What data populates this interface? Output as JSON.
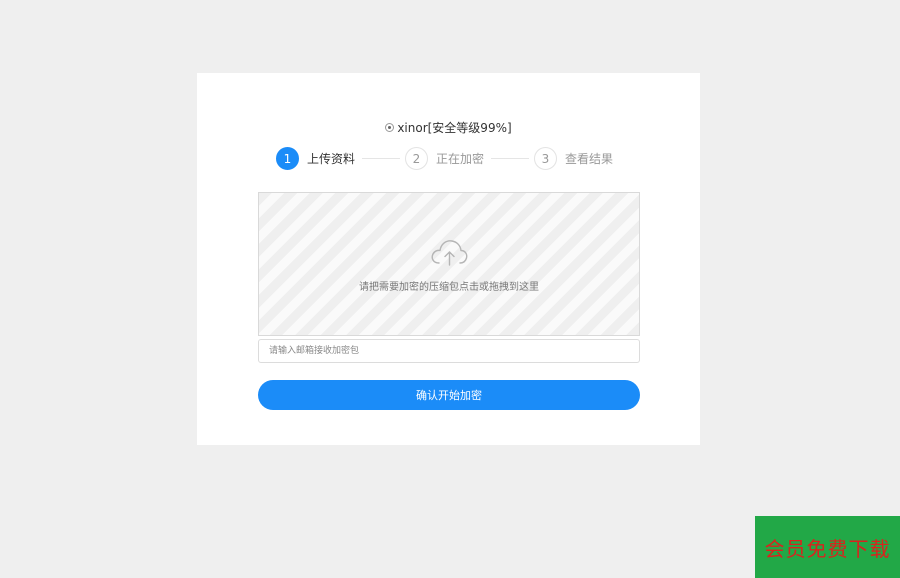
{
  "option": {
    "label": "xinor[安全等级99%]"
  },
  "steps": [
    {
      "number": "1",
      "label": "上传资料",
      "active": true
    },
    {
      "number": "2",
      "label": "正在加密",
      "active": false
    },
    {
      "number": "3",
      "label": "查看结果",
      "active": false
    }
  ],
  "upload": {
    "icon": "cloud-upload-icon",
    "hint": "请把需要加密的压缩包点击或拖拽到这里"
  },
  "email": {
    "value": "",
    "placeholder": "请输入邮箱接收加密包"
  },
  "submit": {
    "label": "确认开始加密"
  },
  "promo": {
    "text": "会员免费下载"
  },
  "colors": {
    "accent": "#1b8cf8",
    "background": "#efefef",
    "promo_bg": "#22a847",
    "promo_text": "#d9231e"
  }
}
